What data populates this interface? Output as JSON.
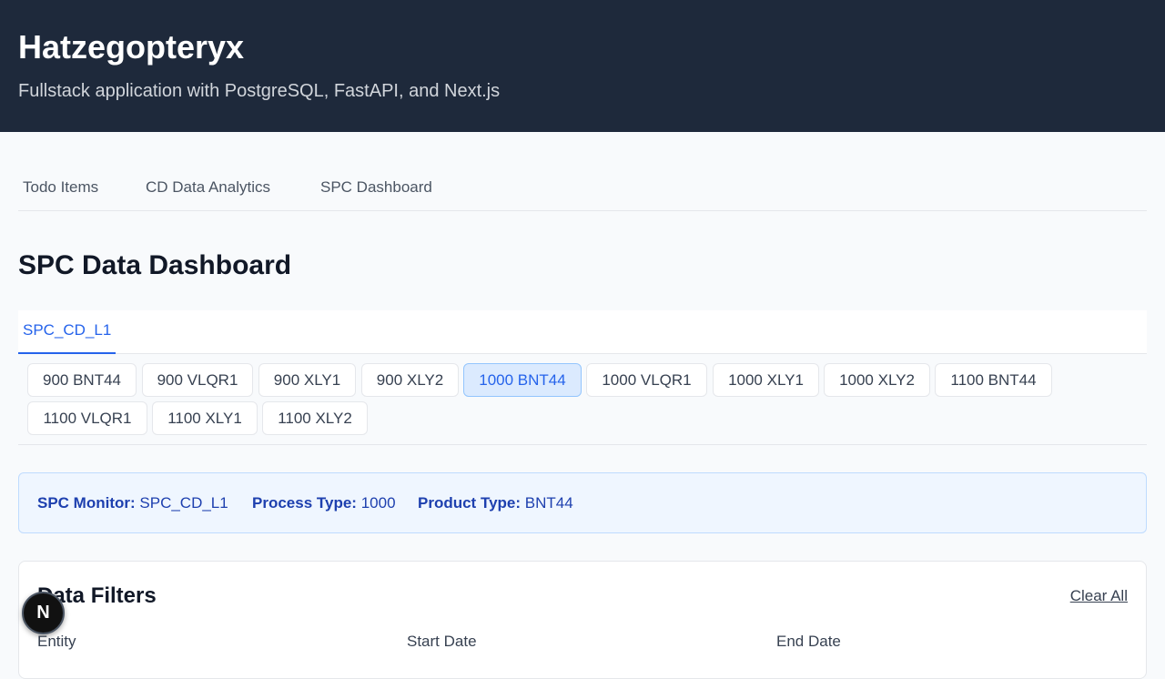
{
  "header": {
    "title": "Hatzegopteryx",
    "subtitle": "Fullstack application with PostgreSQL, FastAPI, and Next.js"
  },
  "nav": {
    "items": [
      {
        "label": "Todo Items"
      },
      {
        "label": "CD Data Analytics"
      },
      {
        "label": "SPC Dashboard"
      }
    ]
  },
  "page": {
    "title": "SPC Data Dashboard"
  },
  "monitor_tabs": [
    {
      "label": "SPC_CD_L1",
      "active": true
    }
  ],
  "process_product_chips": [
    {
      "label": "900 BNT44"
    },
    {
      "label": "900 VLQR1"
    },
    {
      "label": "900 XLY1"
    },
    {
      "label": "900 XLY2"
    },
    {
      "label": "1000 BNT44",
      "active": true
    },
    {
      "label": "1000 VLQR1"
    },
    {
      "label": "1000 XLY1"
    },
    {
      "label": "1000 XLY2"
    },
    {
      "label": "1100 BNT44"
    },
    {
      "label": "1100 VLQR1"
    },
    {
      "label": "1100 XLY1"
    },
    {
      "label": "1100 XLY2"
    }
  ],
  "selection_info": {
    "monitor_label": "SPC Monitor:",
    "monitor_value": "SPC_CD_L1",
    "process_label": "Process Type:",
    "process_value": "1000",
    "product_label": "Product Type:",
    "product_value": "BNT44"
  },
  "filters": {
    "title": "Data Filters",
    "clear_label": "Clear All",
    "labels": {
      "entity": "Entity",
      "start_date": "Start Date",
      "end_date": "End Date"
    }
  },
  "badge": {
    "letter": "N"
  },
  "colors": {
    "header_bg": "#1e293b",
    "accent": "#2563eb",
    "active_chip_bg": "#dbeafe",
    "info_bg": "#eff6ff",
    "info_text": "#1e40af"
  }
}
